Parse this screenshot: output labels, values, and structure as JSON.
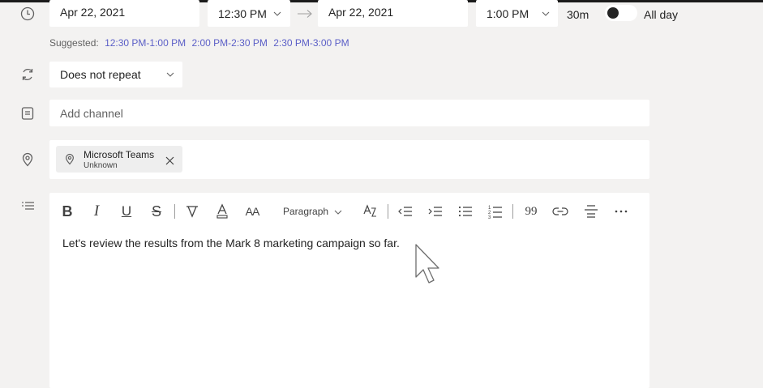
{
  "datetime": {
    "start_date": "Apr 22, 2021",
    "start_time": "12:30 PM",
    "end_date": "Apr 22, 2021",
    "end_time": "1:00 PM",
    "duration": "30m",
    "all_day_label": "All day",
    "all_day_enabled": false
  },
  "suggested": {
    "label": "Suggested:",
    "slots": [
      "12:30 PM-1:00 PM",
      "2:00 PM-2:30 PM",
      "2:30 PM-3:00 PM"
    ]
  },
  "repeat": {
    "value": "Does not repeat"
  },
  "channel": {
    "placeholder": "Add channel"
  },
  "location": {
    "name": "Microsoft Teams",
    "status": "Unknown"
  },
  "toolbar": {
    "bold": "B",
    "italic": "I",
    "underline": "U",
    "strike": "S",
    "font_size": "AA",
    "paragraph": "Paragraph",
    "quote": "99"
  },
  "body_text": "Let's review the results from the Mark 8 marketing campaign so far.",
  "icons": {
    "row1": "clock-icon",
    "row2": "repeat-icon",
    "row3": "channel-icon",
    "row4": "location-pin-icon",
    "row5": "details-list-icon"
  },
  "colors": {
    "accent": "#5b5fc7",
    "background": "#f3f2f1",
    "field": "#ffffff"
  }
}
